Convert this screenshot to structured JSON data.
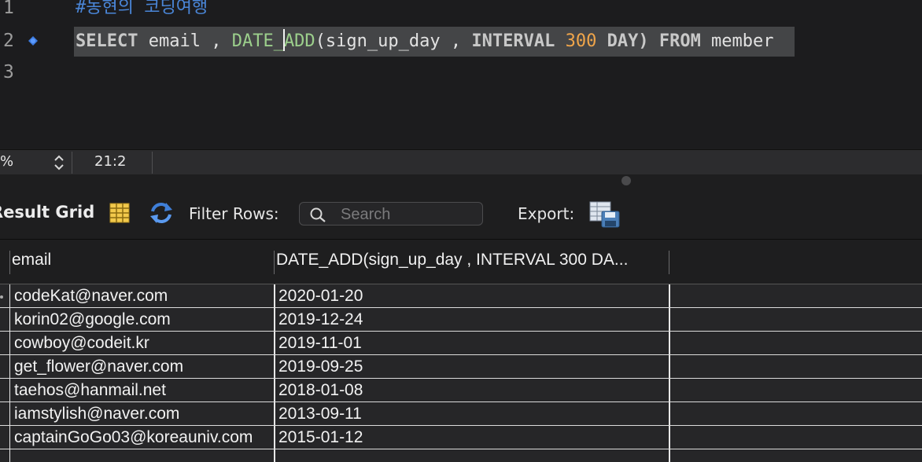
{
  "editor": {
    "lines": [
      {
        "number": "1",
        "comment": "#농현의 코딩여행"
      },
      {
        "number": "2",
        "tokens": {
          "select": "SELECT",
          "cols": " email , ",
          "func": "DATE_",
          "func2": "ADD",
          "args": "(sign_up_day , ",
          "interval": "INTERVAL",
          "num": "300",
          "day": " DAY)",
          "from": "FROM",
          "table": " member"
        }
      },
      {
        "number": "3"
      }
    ]
  },
  "status_bar": {
    "zoom": "%",
    "cursor_position": "21:2"
  },
  "result_toolbar": {
    "title": "Result Grid",
    "filter_label": "Filter Rows:",
    "search_placeholder": "Search",
    "export_label": "Export:"
  },
  "grid": {
    "columns": [
      "email",
      "DATE_ADD(sign_up_day , INTERVAL 300 DA..."
    ],
    "rows": [
      {
        "email": "codeKat@naver.com",
        "date": "2020-01-20"
      },
      {
        "email": "korin02@google.com",
        "date": "2019-12-24"
      },
      {
        "email": "cowboy@codeit.kr",
        "date": "2019-11-01"
      },
      {
        "email": "get_flower@naver.com",
        "date": "2019-09-25"
      },
      {
        "email": "taehos@hanmail.net",
        "date": "2018-01-08"
      },
      {
        "email": "iamstylish@naver.com",
        "date": "2013-09-11"
      },
      {
        "email": "captainGoGo03@koreauniv.com",
        "date": "2015-01-12"
      },
      {
        "email": "",
        "date": ""
      }
    ]
  },
  "colors": {
    "comment": "#4a86d8",
    "function": "#9ccf8c",
    "number": "#f0a54a",
    "breakpoint": "#3d7be0"
  }
}
